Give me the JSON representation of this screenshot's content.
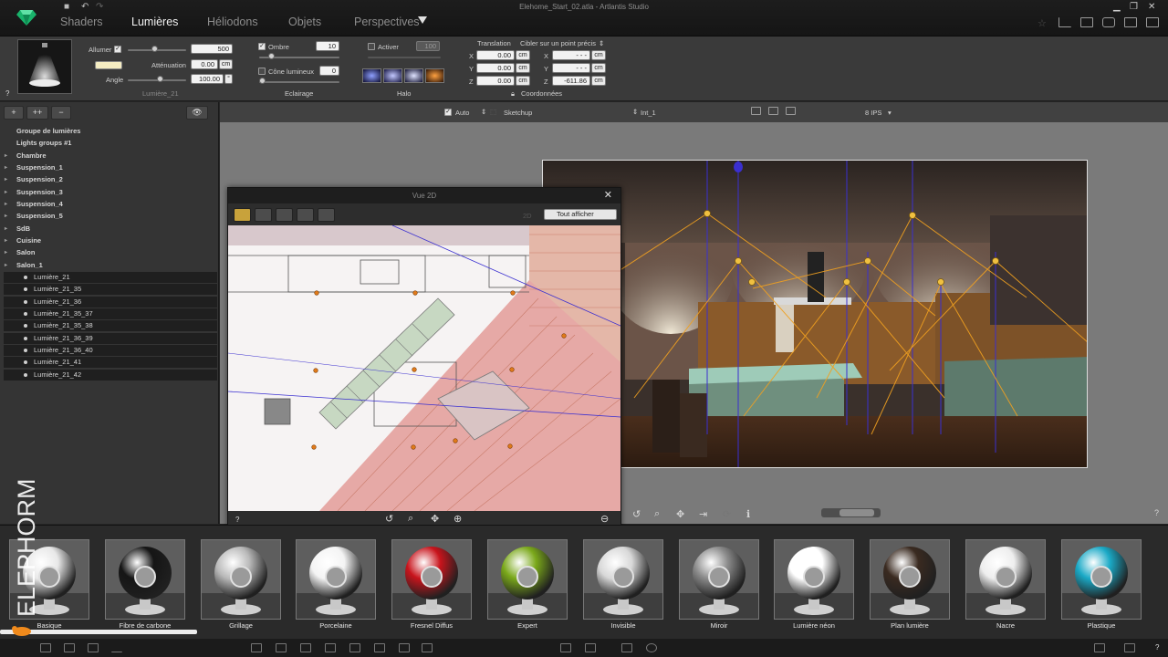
{
  "window": {
    "title": "Elehome_Start_02.atla - Artlantis Studio"
  },
  "nav": {
    "tabs": [
      {
        "label": "Shaders"
      },
      {
        "label": "Lumières"
      },
      {
        "label": "Héliodons"
      },
      {
        "label": "Objets"
      },
      {
        "label": "Perspectives"
      }
    ],
    "active_tab": "Lumières"
  },
  "light_props": {
    "allumer_label": "Allumer",
    "power_value": "500",
    "attenuation_label": "Atténuation",
    "attenuation_value": "0.00",
    "attenuation_unit": "cm",
    "angle_label": "Angle",
    "angle_value": "100.00",
    "angle_unit": "°",
    "light_name": "Lumière_21",
    "help": "?"
  },
  "eclairage": {
    "ombre_label": "Ombre",
    "ombre_value": "10",
    "cone_label": "Cône lumineux",
    "cone_value": "0",
    "section_label": "Eclairage"
  },
  "halo": {
    "activer_label": "Activer",
    "activer_value": "100",
    "section_label": "Halo"
  },
  "translation": {
    "title": "Translation",
    "target_label": "Cibler sur un point précis",
    "x_label": "X",
    "x_value": "0.00",
    "x_unit": "cm",
    "y_label": "Y",
    "y_value": "0.00",
    "y_unit": "cm",
    "z_label": "Z",
    "z_value": "0.00",
    "z_unit": "cm",
    "tx_label": "X",
    "tx_value": "- - -",
    "tx_unit": "cm",
    "ty_label": "Y",
    "ty_value": "- - -",
    "ty_unit": "cm",
    "tz_label": "Z",
    "tz_value": "-611.86",
    "tz_unit": "cm",
    "coords_label": "Coordonnées"
  },
  "left_panel": {
    "tools": [
      "+",
      "++",
      "−"
    ],
    "tree": [
      {
        "label": "Groupe de lumières",
        "level": 0,
        "arrow": false
      },
      {
        "label": "Lights groups #1",
        "level": 0,
        "arrow": false
      },
      {
        "label": "Chambre",
        "level": 0,
        "arrow": true
      },
      {
        "label": "Suspension_1",
        "level": 0,
        "arrow": true
      },
      {
        "label": "Suspension_2",
        "level": 0,
        "arrow": true
      },
      {
        "label": "Suspension_3",
        "level": 0,
        "arrow": true
      },
      {
        "label": "Suspension_4",
        "level": 0,
        "arrow": true
      },
      {
        "label": "Suspension_5",
        "level": 0,
        "arrow": true
      },
      {
        "label": "SdB",
        "level": 0,
        "arrow": true
      },
      {
        "label": "Cuisine",
        "level": 0,
        "arrow": true
      },
      {
        "label": "Salon",
        "level": 0,
        "arrow": true
      },
      {
        "label": "Salon_1",
        "level": 0,
        "arrow": true
      },
      {
        "label": "Lumière_21",
        "level": 1
      },
      {
        "label": "Lumière_21_35",
        "level": 1
      },
      {
        "label": "Lumière_21_36",
        "level": 1
      },
      {
        "label": "Lumière_21_35_37",
        "level": 1
      },
      {
        "label": "Lumière_21_35_38",
        "level": 1
      },
      {
        "label": "Lumière_21_36_39",
        "level": 1
      },
      {
        "label": "Lumière_21_36_40",
        "level": 1
      },
      {
        "label": "Lumière_21_41",
        "level": 1
      },
      {
        "label": "Lumière_21_42",
        "level": 1
      }
    ]
  },
  "viewport": {
    "auto_label": "Auto",
    "sketchup_label": "Sketchup",
    "view_label": "Int_1",
    "fps_label": "8 IPS",
    "help": "?"
  },
  "vue2d": {
    "title": "Vue 2D",
    "dropdown": "Tout afficher",
    "zoom_hint": "2D",
    "help": "?"
  },
  "materials": [
    {
      "label": "Basique",
      "color": "#e8e8e8"
    },
    {
      "label": "Fibre de carbone",
      "color": "#151515"
    },
    {
      "label": "Grillage",
      "color": "#b9b9b9"
    },
    {
      "label": "Porcelaine",
      "color": "#f4f4f4"
    },
    {
      "label": "Fresnel Diffus",
      "color": "#c8141c"
    },
    {
      "label": "Expert",
      "color": "#7aa81a"
    },
    {
      "label": "Invisible",
      "color": "#d8d8d8"
    },
    {
      "label": "Miroir",
      "color": "#8b8b8b"
    },
    {
      "label": "Lumière néon",
      "color": "#ffffff"
    },
    {
      "label": "Plan lumière",
      "color": "#3a2a20"
    },
    {
      "label": "Nacre",
      "color": "#eeeeee"
    },
    {
      "label": "Plastique",
      "color": "#1aa9c6"
    }
  ],
  "watermark": {
    "text": "ELEPHORM"
  },
  "colors": {
    "accent_gold": "#c8a23b",
    "orange_light": "#f0a020",
    "blue_guide": "#3a2fd0"
  }
}
